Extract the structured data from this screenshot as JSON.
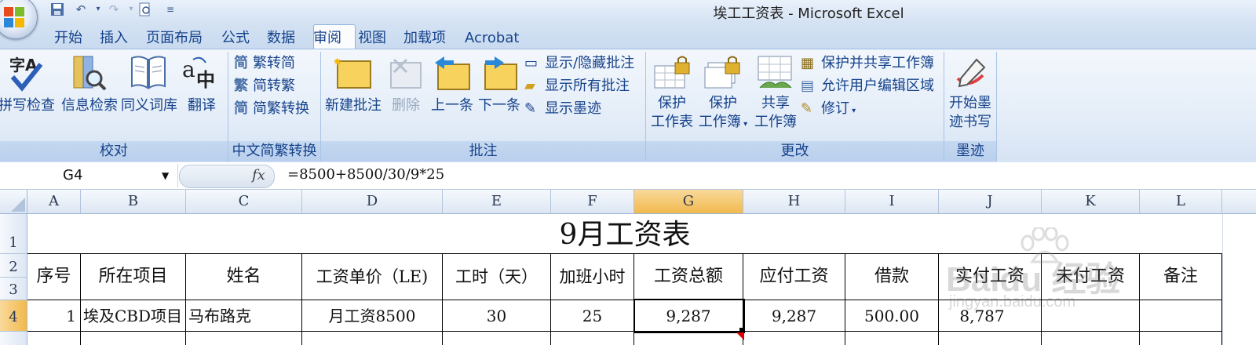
{
  "window": {
    "title": "埃工工资表 - Microsoft Excel"
  },
  "tabs": [
    "开始",
    "插入",
    "页面布局",
    "公式",
    "数据",
    "审阅",
    "视图",
    "加载项",
    "Acrobat"
  ],
  "ribbon": {
    "groups": {
      "proofing": {
        "label": "校对",
        "buttons": [
          "拼写检查",
          "信息检索",
          "同义词库",
          "翻译"
        ]
      },
      "chinese": {
        "label": "中文简繁转换",
        "buttons": [
          "繁转简",
          "简转繁",
          "简繁转换"
        ]
      },
      "comments": {
        "label": "批注",
        "new": "新建批注",
        "delete": "删除",
        "prev": "上一条",
        "next": "下一条",
        "show_hide": "显示/隐藏批注",
        "show_all": "显示所有批注",
        "show_ink": "显示墨迹"
      },
      "changes": {
        "label": "更改",
        "protect_sheet": [
          "保护",
          "工作表"
        ],
        "protect_book": [
          "保护",
          "工作簿"
        ],
        "share_book": [
          "共享",
          "工作簿"
        ],
        "protect_share": "保护并共享工作簿",
        "allow_edit": "允许用户编辑区域",
        "track": "修订"
      },
      "ink": {
        "label": "墨迹",
        "start": [
          "开始墨",
          "迹书写"
        ]
      }
    }
  },
  "formula_bar": {
    "name_box": "G4",
    "fx": "fx",
    "formula": "=8500+8500/30/9*25"
  },
  "sheet": {
    "columns": [
      "A",
      "B",
      "C",
      "D",
      "E",
      "F",
      "G",
      "H",
      "I",
      "J",
      "K",
      "L"
    ],
    "rows": [
      "1",
      "2",
      "3",
      "4"
    ],
    "title": "9月工资表",
    "headers": [
      "序号",
      "所在项目",
      "姓名",
      "工资单价（LE)",
      "工时（天）",
      "加班小时",
      "工资总额",
      "应付工资",
      "借款",
      "实付工资",
      "未付工资",
      "备注"
    ],
    "row4": [
      "1",
      "埃及CBD项目",
      "马布路克",
      "月工资8500",
      "30",
      "25",
      "9,287",
      "9,287",
      "500.00",
      "8,787",
      "",
      ""
    ]
  },
  "watermark": {
    "logo": "Baidu 经验",
    "url": "jingyan.baidu.com"
  }
}
